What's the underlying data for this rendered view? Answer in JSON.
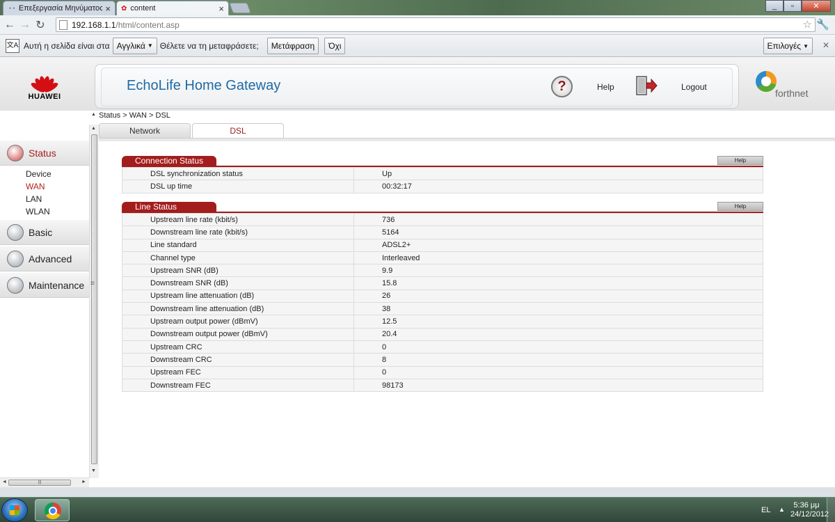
{
  "browser": {
    "tabs": [
      {
        "title": "Επεξεργασία Μηνύματος",
        "active": false
      },
      {
        "title": "content",
        "active": true
      }
    ],
    "url_host": "192.168.1.1",
    "url_path": "/html/content.asp"
  },
  "translate_bar": {
    "prefix": "Αυτή η σελίδα είναι στα",
    "language": "Αγγλικά",
    "question": "Θέλετε να τη μεταφράσετε;",
    "translate_button": "Μετάφραση",
    "no_button": "Όχι",
    "options_button": "Επιλογές"
  },
  "header": {
    "brand": "HUAWEI",
    "title": "EchoLife Home Gateway",
    "help_label": "Help",
    "logout_label": "Logout",
    "isp": "forthnet"
  },
  "sidebar": {
    "menu": [
      {
        "label": "Status",
        "open": true,
        "items": [
          "Device",
          "WAN",
          "LAN",
          "WLAN"
        ],
        "active_item": "WAN"
      },
      {
        "label": "Basic"
      },
      {
        "label": "Advanced"
      },
      {
        "label": "Maintenance"
      }
    ]
  },
  "content": {
    "breadcrumb": "Status > WAN > DSL",
    "tabs": [
      {
        "label": "Network",
        "active": false
      },
      {
        "label": "DSL",
        "active": true
      }
    ],
    "connection_status": {
      "title": "Connection Status",
      "help": "Help",
      "rows": [
        {
          "label": "DSL synchronization status",
          "value": "Up"
        },
        {
          "label": "DSL up time",
          "value": "00:32:17"
        }
      ]
    },
    "line_status": {
      "title": "Line Status",
      "help": "Help",
      "rows": [
        {
          "label": "Upstream line rate (kbit/s)",
          "value": "736"
        },
        {
          "label": "Downstream line rate (kbit/s)",
          "value": "5164"
        },
        {
          "label": "Line standard",
          "value": "ADSL2+"
        },
        {
          "label": "Channel type",
          "value": "Interleaved"
        },
        {
          "label": "Upstream SNR (dB)",
          "value": "9.9"
        },
        {
          "label": "Downstream SNR (dB)",
          "value": "15.8"
        },
        {
          "label": "Upstream line attenuation (dB)",
          "value": "26"
        },
        {
          "label": "Downstream line attenuation (dB)",
          "value": "38"
        },
        {
          "label": "Upstream output power (dBmV)",
          "value": "12.5"
        },
        {
          "label": "Downstream output power (dBmV)",
          "value": "20.4"
        },
        {
          "label": "Upstream CRC",
          "value": "0"
        },
        {
          "label": "Downstream CRC",
          "value": "8"
        },
        {
          "label": "Upstream FEC",
          "value": "0"
        },
        {
          "label": "Downstream FEC",
          "value": "98173"
        }
      ]
    }
  },
  "taskbar": {
    "language": "EL",
    "time": "5:36 μμ",
    "date": "24/12/2012"
  },
  "colors": {
    "accent_red": "#a31d1d",
    "title_blue": "#1e6aa5"
  }
}
